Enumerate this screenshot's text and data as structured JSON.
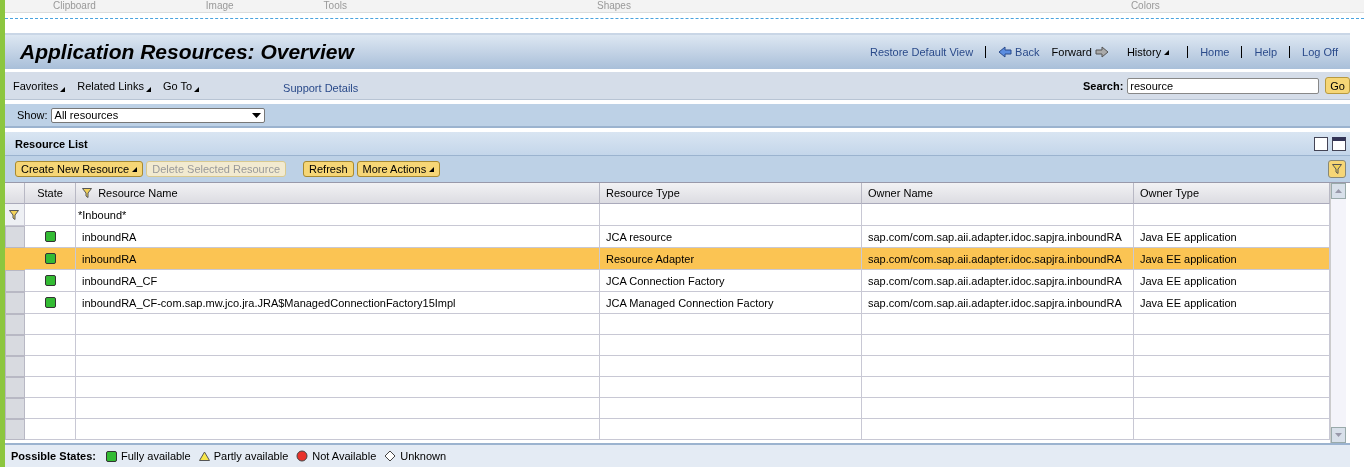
{
  "ribbon": {
    "groups": [
      "Clipboard",
      "Image",
      "Tools",
      "Shapes",
      "Colors"
    ]
  },
  "header": {
    "title": "Application Resources: Overview",
    "links": [
      {
        "kind": "link",
        "label": "Restore Default View"
      },
      {
        "kind": "back",
        "label": "Back"
      },
      {
        "kind": "forward",
        "label": "Forward"
      },
      {
        "kind": "menu",
        "label": "History"
      },
      {
        "kind": "link",
        "label": "Home"
      },
      {
        "kind": "link",
        "label": "Help"
      },
      {
        "kind": "link",
        "label": "Log Off"
      }
    ]
  },
  "nav": {
    "menus": [
      "Favorites",
      "Related Links",
      "Go To"
    ],
    "support_link": "Support Details",
    "search_label": "Search:",
    "search_value": "resource",
    "go_button": "Go"
  },
  "show": {
    "label": "Show:",
    "value": "All resources"
  },
  "resource_list": {
    "title": "Resource List",
    "buttons": [
      {
        "label": "Create New Resource",
        "menu": true,
        "disabled": false
      },
      {
        "label": "Delete Selected Resource",
        "menu": false,
        "disabled": true
      },
      {
        "label": "Refresh",
        "menu": false,
        "disabled": false
      },
      {
        "label": "More Actions",
        "menu": true,
        "disabled": false
      }
    ],
    "columns": [
      "State",
      "Resource Name",
      "Resource Type",
      "Owner Name",
      "Owner Type"
    ],
    "filter": "*Inbound*",
    "rows": [
      {
        "kind": "fully",
        "name": "inboundRA",
        "type": "JCA resource",
        "owner": "sap.com/com.sap.aii.adapter.idoc.sapjra.inboundRA",
        "owner_type": "Java EE application",
        "selected": false
      },
      {
        "kind": "fully",
        "name": "inboundRA",
        "type": "Resource Adapter",
        "owner": "sap.com/com.sap.aii.adapter.idoc.sapjra.inboundRA",
        "owner_type": "Java EE application",
        "selected": true
      },
      {
        "kind": "fully",
        "name": "inboundRA_CF",
        "type": "JCA Connection Factory",
        "owner": "sap.com/com.sap.aii.adapter.idoc.sapjra.inboundRA",
        "owner_type": "Java EE application",
        "selected": false
      },
      {
        "kind": "fully",
        "name": "inboundRA_CF-com.sap.mw.jco.jra.JRA$ManagedConnectionFactory15Impl",
        "type": "JCA Managed Connection Factory",
        "owner": "sap.com/com.sap.aii.adapter.idoc.sapjra.inboundRA",
        "owner_type": "Java EE application",
        "selected": false
      }
    ]
  },
  "legend": {
    "label": "Possible States:",
    "items": [
      {
        "kind": "fully",
        "label": "Fully available"
      },
      {
        "kind": "partly",
        "label": "Partly available"
      },
      {
        "kind": "not",
        "label": "Not Available"
      },
      {
        "kind": "unknown",
        "label": "Unknown"
      }
    ]
  }
}
